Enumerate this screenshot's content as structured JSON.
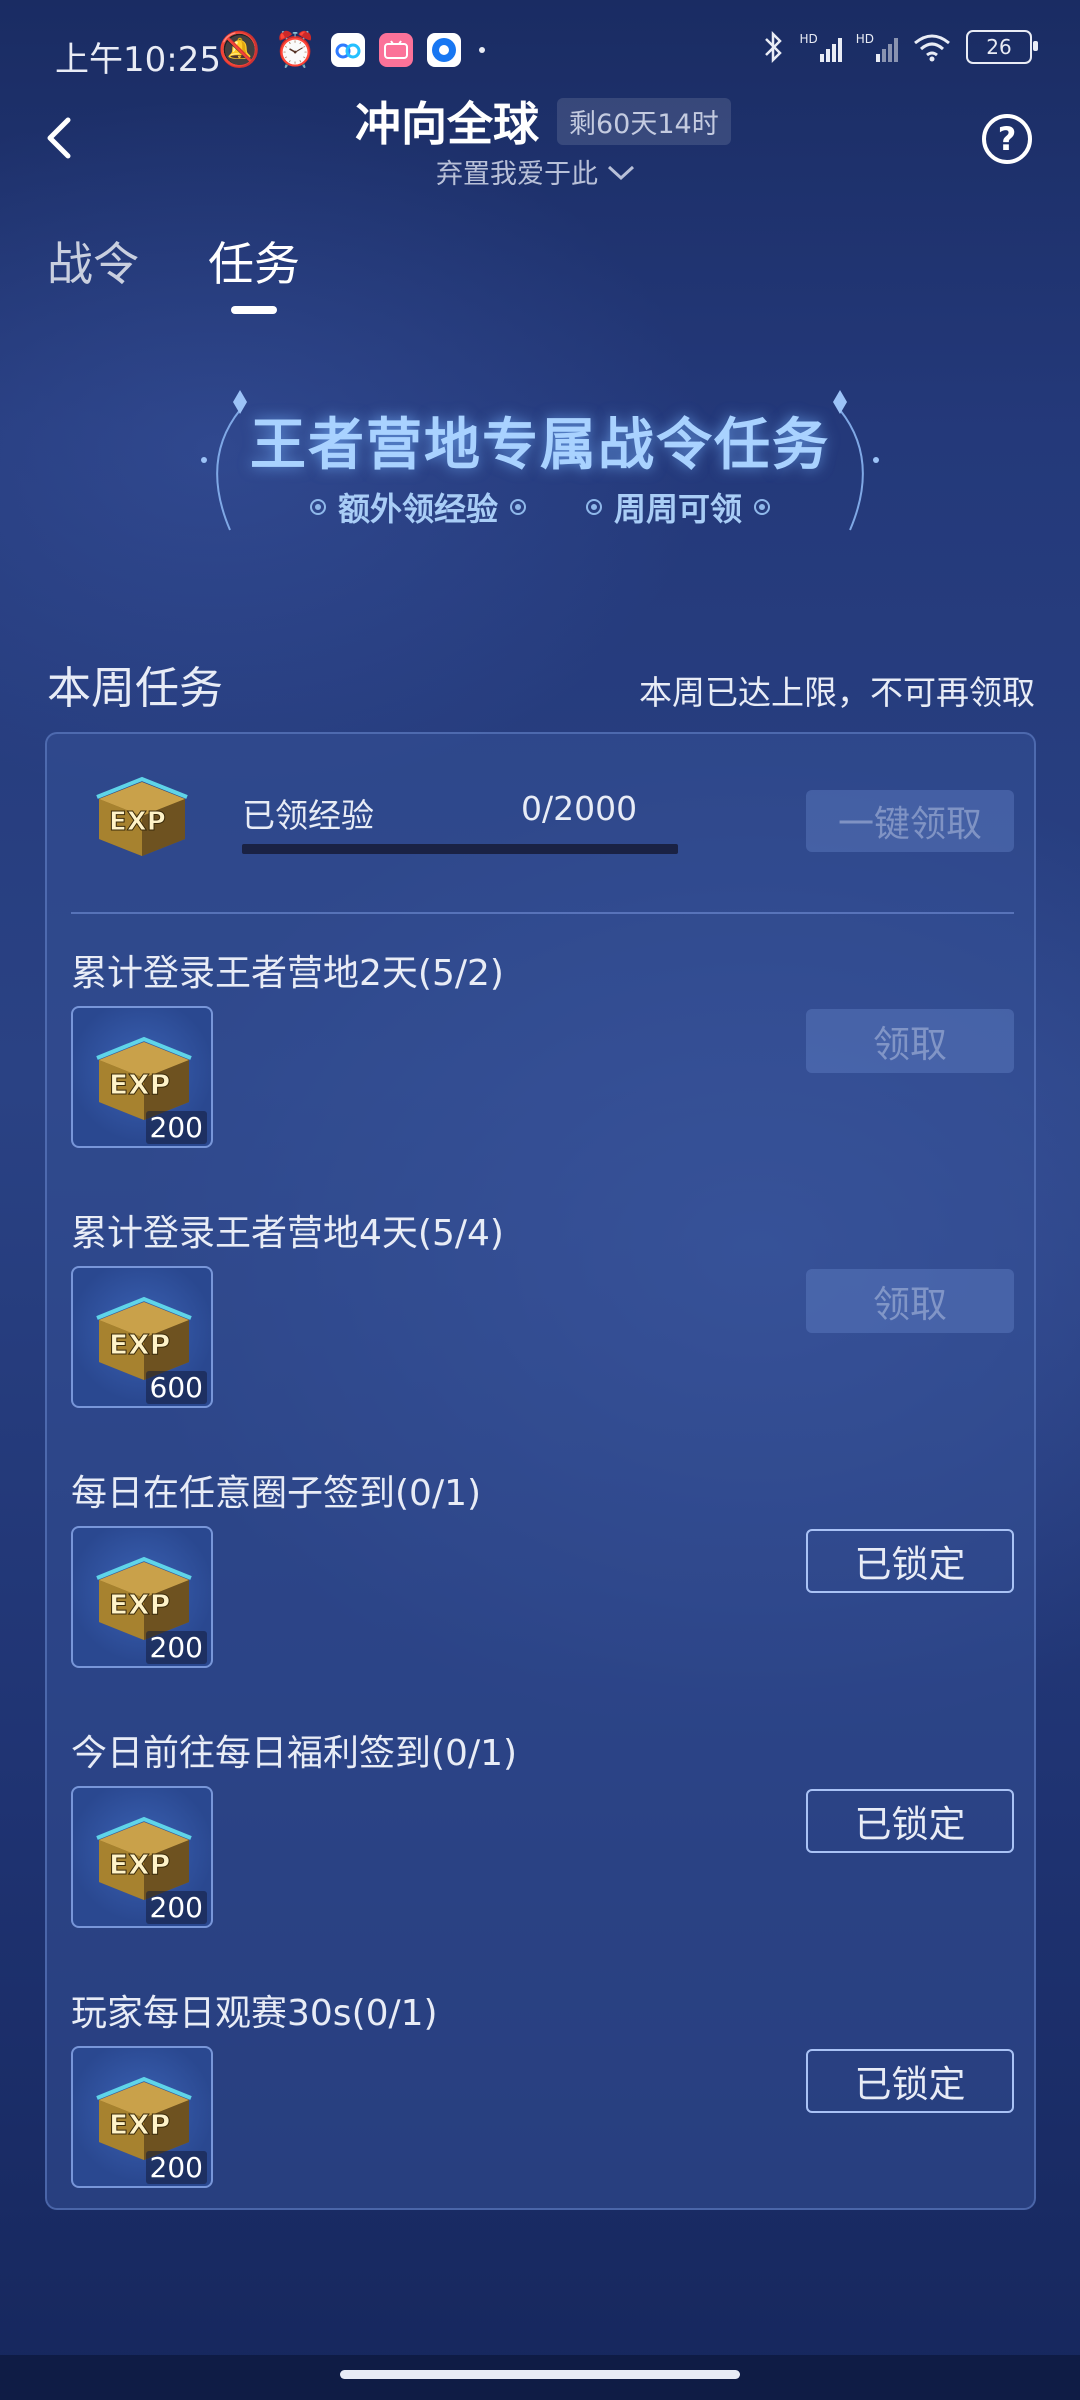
{
  "status_bar": {
    "time": "上午10:25",
    "battery": "26",
    "network_badge_1": "HD",
    "network_badge_2": "HD"
  },
  "header": {
    "title": "冲向全球",
    "remaining": "剩60天14时",
    "subtitle": "弃置我爱于此"
  },
  "tabs": [
    {
      "label": "战令",
      "active": false
    },
    {
      "label": "任务",
      "active": true
    }
  ],
  "banner": {
    "title": "王者营地专属战令任务",
    "tag_1": "额外领经验",
    "tag_2": "周周可领"
  },
  "section": {
    "title": "本周任务",
    "limit_note": "本周已达上限，不可再领取"
  },
  "exp_summary": {
    "label": "已领经验",
    "progress": "0/2000",
    "progress_fraction": 0,
    "claim_all_label": "一键领取"
  },
  "tasks": [
    {
      "title": "累计登录王者营地2天(5/2)",
      "reward": "200",
      "button": "领取",
      "state": "disabled"
    },
    {
      "title": "累计登录王者营地4天(5/4)",
      "reward": "600",
      "button": "领取",
      "state": "disabled"
    },
    {
      "title": "每日在任意圈子签到(0/1)",
      "reward": "200",
      "button": "已锁定",
      "state": "locked"
    },
    {
      "title": "今日前往每日福利签到(0/1)",
      "reward": "200",
      "button": "已锁定",
      "state": "locked"
    },
    {
      "title": "玩家每日观赛30s(0/1)",
      "reward": "200",
      "button": "已锁定",
      "state": "locked"
    }
  ],
  "reward_icon": {
    "name": "exp-chest-icon",
    "text": "EXP"
  },
  "colors": {
    "background": "#24397a",
    "banner_text": "#a9d2ff",
    "locked_border": "#a9c2f5"
  }
}
